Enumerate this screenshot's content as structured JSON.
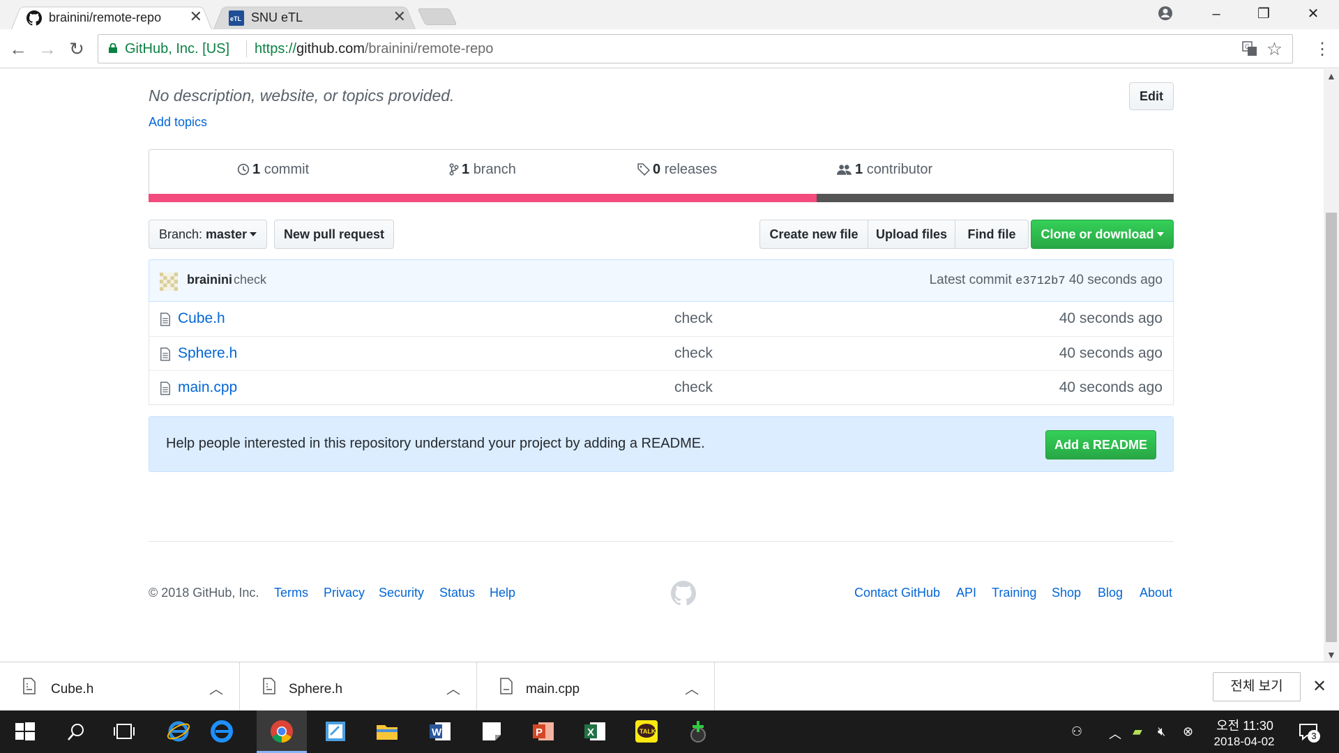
{
  "browser": {
    "tabs": [
      {
        "title": "brainini/remote-repo",
        "active": true
      },
      {
        "title": "SNU eTL",
        "active": false
      }
    ],
    "security_label": "GitHub, Inc. [US]",
    "url": {
      "scheme": "https://",
      "host": "github.com",
      "path": "/brainini/remote-repo"
    }
  },
  "repo": {
    "description": "No description, website, or topics provided.",
    "add_topics": "Add topics",
    "edit_label": "Edit",
    "stats": {
      "commits_count": "1",
      "commits_label": "commit",
      "branches_count": "1",
      "branches_label": "branch",
      "releases_count": "0",
      "releases_label": "releases",
      "contributors_count": "1",
      "contributors_label": "contributor"
    },
    "language_bar": [
      {
        "color": "#f34b7d",
        "fraction": 0.652
      },
      {
        "color": "#555555",
        "fraction": 0.348
      }
    ],
    "branch_prefix": "Branch:",
    "branch_name": "master",
    "new_pull_request": "New pull request",
    "create_new_file": "Create new file",
    "upload_files": "Upload files",
    "find_file": "Find file",
    "clone_or_download": "Clone or download",
    "latest_commit": {
      "author": "brainini",
      "message": "check",
      "prefix": "Latest commit",
      "sha": "e3712b7",
      "age": "40 seconds ago"
    },
    "files": [
      {
        "name": "Cube.h",
        "message": "check",
        "age": "40 seconds ago"
      },
      {
        "name": "Sphere.h",
        "message": "check",
        "age": "40 seconds ago"
      },
      {
        "name": "main.cpp",
        "message": "check",
        "age": "40 seconds ago"
      }
    ],
    "readme_prompt": "Help people interested in this repository understand your project by adding a README.",
    "add_readme": "Add a README"
  },
  "footer": {
    "copyright": "© 2018 GitHub, Inc.",
    "left_links": [
      "Terms",
      "Privacy",
      "Security",
      "Status",
      "Help"
    ],
    "right_links": [
      "Contact GitHub",
      "API",
      "Training",
      "Shop",
      "Blog",
      "About"
    ]
  },
  "downloads": {
    "items": [
      "Cube.h",
      "Sphere.h",
      "main.cpp"
    ],
    "show_all": "전체 보기"
  },
  "taskbar": {
    "time": "오전 11:30",
    "date": "2018-04-02",
    "notification_count": "3",
    "accent": "#1b1b1b"
  }
}
